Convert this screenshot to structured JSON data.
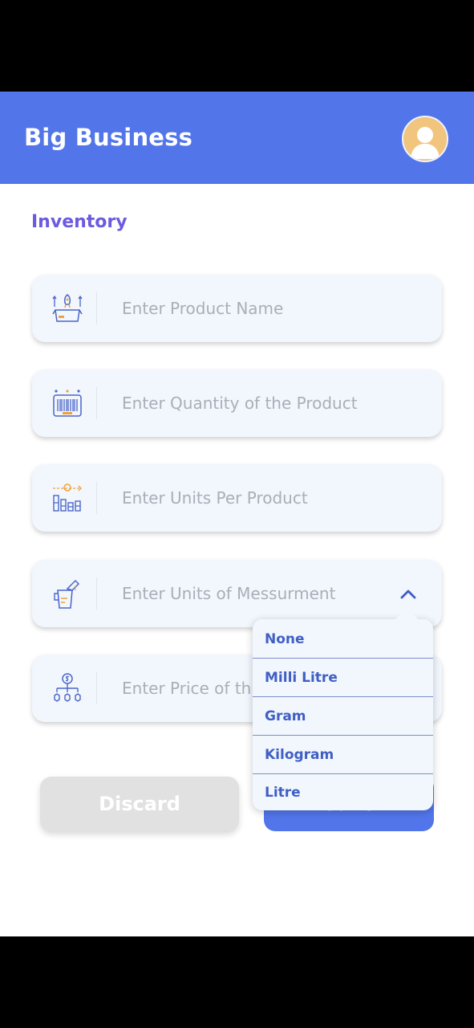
{
  "app": {
    "title": "Big Business"
  },
  "page": {
    "section_title": "Inventory"
  },
  "fields": [
    {
      "placeholder": "Enter Product Name",
      "icon": "product-launch-icon"
    },
    {
      "placeholder": "Enter Quantity of the Product",
      "icon": "barcode-icon"
    },
    {
      "placeholder": "Enter Units Per Product",
      "icon": "units-chart-icon"
    },
    {
      "placeholder": "Enter Units of Messurment",
      "icon": "measuring-cup-icon"
    },
    {
      "placeholder": "Enter Price of th",
      "icon": "price-hierarchy-icon"
    }
  ],
  "dropdown": {
    "options": [
      "None",
      "Milli Litre",
      "Gram",
      "Kilogram",
      "Litre"
    ]
  },
  "buttons": {
    "discard": "Discard",
    "save": "Save"
  },
  "colors": {
    "primary": "#5275ea",
    "accent": "#6a5be0",
    "field_bg": "#f2f6fd",
    "icon_blue": "#4a66c9",
    "icon_orange": "#f0a23a"
  }
}
